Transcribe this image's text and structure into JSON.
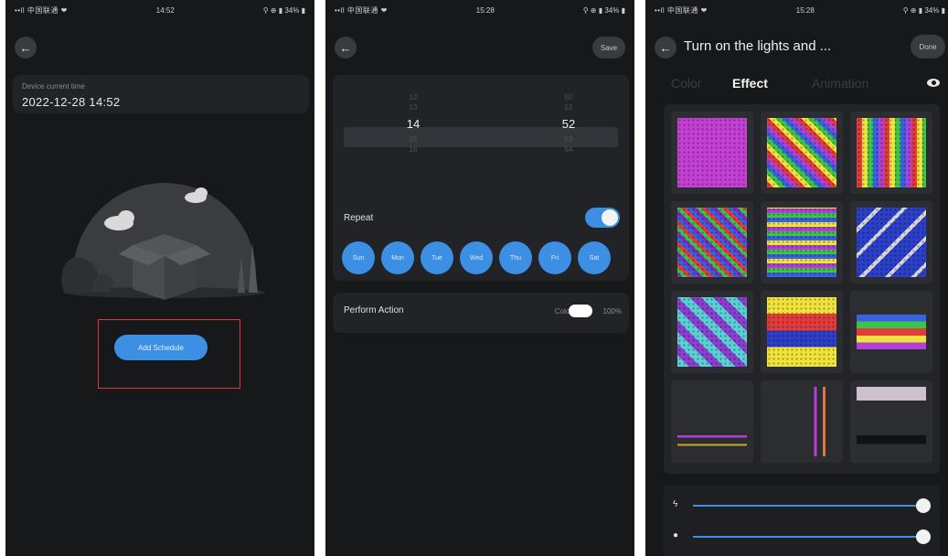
{
  "screen1": {
    "status": {
      "carrier": "••ll 中国联通 ❤",
      "time": "14:52",
      "right": "⚲ ⊕ ▮ 34% ▮"
    },
    "time_card": {
      "label": "Device current time",
      "value": "2022-12-28 14:52"
    },
    "add_button_label": "Add Schedule"
  },
  "screen2": {
    "status": {
      "carrier": "••ll 中国联通 ❤",
      "time": "15:28",
      "right": "⚲ ⊕ ▮ 34% ▮"
    },
    "save_label": "Save",
    "picker": {
      "hours": [
        "12",
        "13",
        "14",
        "15",
        "16"
      ],
      "minutes": [
        "50",
        "51",
        "52",
        "53",
        "54"
      ]
    },
    "repeat_label": "Repeat",
    "repeat_on": true,
    "days": [
      "Sun",
      "Mon",
      "Tue",
      "Wed",
      "Thu",
      "Fri",
      "Sat"
    ],
    "action": {
      "label": "Perform Action",
      "color_label": "Color",
      "percent": "100%"
    }
  },
  "screen3": {
    "status": {
      "carrier": "••ll 中国联通 ❤",
      "time": "15:28",
      "right": "⚲ ⊕ ▮ 34% ▮"
    },
    "title": "Turn on the lights and ...",
    "done_label": "Done",
    "tabs": {
      "color": "Color",
      "effect": "Effect",
      "animation": "Animation"
    },
    "brightness_level": 1.0,
    "speed_level": 1.0
  },
  "colors": {
    "accent": "#3d8fe3",
    "background": "#17181a",
    "card": "#222326",
    "highlight": "#e03a3a"
  }
}
